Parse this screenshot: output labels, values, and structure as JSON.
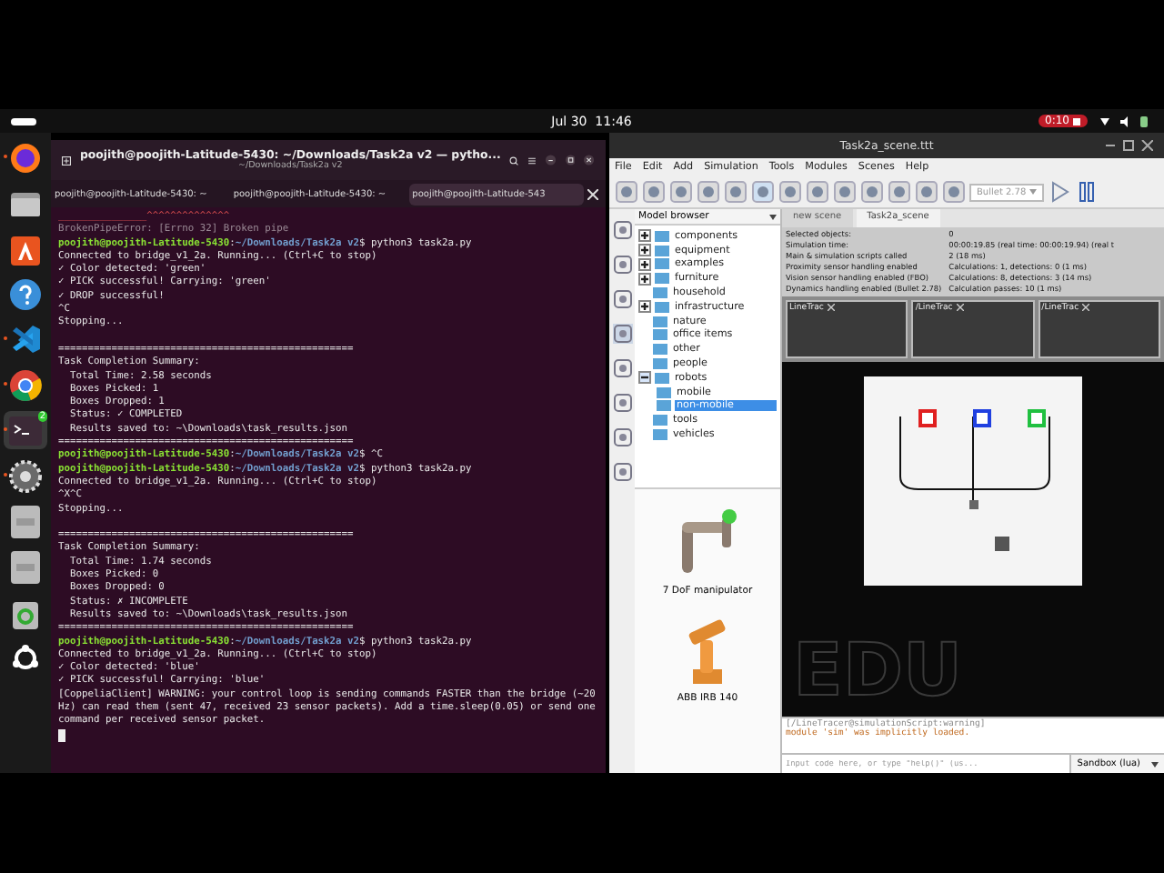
{
  "top_bar": {
    "date": "Jul 30",
    "time": "11:46",
    "recording": "0:10"
  },
  "dock": [
    {
      "kind": "browser",
      "running": true,
      "selected": false
    },
    {
      "kind": "files",
      "running": false,
      "selected": false
    },
    {
      "kind": "store",
      "running": false,
      "selected": false
    },
    {
      "kind": "help",
      "running": false,
      "selected": false
    },
    {
      "kind": "editor",
      "running": true,
      "selected": false
    },
    {
      "kind": "chrome",
      "running": true,
      "selected": false
    },
    {
      "kind": "terminal",
      "running": true,
      "selected": true,
      "badge": "2"
    },
    {
      "kind": "settings",
      "running": true,
      "selected": false
    },
    {
      "kind": "drive",
      "running": false,
      "selected": false
    },
    {
      "kind": "drive",
      "running": false,
      "selected": false
    },
    {
      "kind": "trash",
      "running": false,
      "selected": false
    },
    {
      "kind": "apps",
      "running": false,
      "selected": false
    }
  ],
  "terminal": {
    "title": "poojith@poojith-Latitude-5430: ~/Downloads/Task2a v2 — pytho...",
    "subtitle": "~/Downloads/Task2a v2",
    "tabs": [
      {
        "label": "poojith@poojith-Latitude-5430: ~",
        "selected": false
      },
      {
        "label": "poojith@poojith-Latitude-5430: ~",
        "selected": false
      },
      {
        "label": "poojith@poojith-Latitude-543",
        "selected": true
      }
    ],
    "lines": [
      {
        "kind": "marker",
        "text": "_______________^^^^^^^^^^^^^^"
      },
      {
        "kind": "error",
        "text": "BrokenPipeError: [Errno 32] Broken pipe"
      },
      {
        "kind": "prompt",
        "user": "poojith@poojith-Latitude-5430",
        "sep": ":",
        "path": "~/Downloads/Task2a v2",
        "text": "$ python3 task2a.py"
      },
      {
        "kind": "text",
        "text": "Connected to bridge_v1_2a. Running... (Ctrl+C to stop)"
      },
      {
        "kind": "text",
        "text": "✓ Color detected: 'green'"
      },
      {
        "kind": "text",
        "text": "✓ PICK successful! Carrying: 'green'"
      },
      {
        "kind": "text",
        "text": "✓ DROP successful!"
      },
      {
        "kind": "text",
        "text": "^C"
      },
      {
        "kind": "text",
        "text": "Stopping..."
      },
      {
        "kind": "blank"
      },
      {
        "kind": "text",
        "text": "=================================================="
      },
      {
        "kind": "text",
        "text": "Task Completion Summary:"
      },
      {
        "kind": "text",
        "text": "  Total Time: 2.58 seconds"
      },
      {
        "kind": "text",
        "text": "  Boxes Picked: 1"
      },
      {
        "kind": "text",
        "text": "  Boxes Dropped: 1"
      },
      {
        "kind": "text",
        "text": "  Status: ✓ COMPLETED"
      },
      {
        "kind": "text",
        "text": "  Results saved to: ~\\Downloads\\task_results.json"
      },
      {
        "kind": "text",
        "text": "=================================================="
      },
      {
        "kind": "prompt",
        "user": "poojith@poojith-Latitude-5430",
        "sep": ":",
        "path": "~/Downloads/Task2a v2",
        "text": "$ ^C"
      },
      {
        "kind": "prompt",
        "user": "poojith@poojith-Latitude-5430",
        "sep": ":",
        "path": "~/Downloads/Task2a v2",
        "text": "$ python3 task2a.py"
      },
      {
        "kind": "text",
        "text": "Connected to bridge_v1_2a. Running... (Ctrl+C to stop)"
      },
      {
        "kind": "text",
        "text": "^X^C"
      },
      {
        "kind": "text",
        "text": "Stopping..."
      },
      {
        "kind": "blank"
      },
      {
        "kind": "text",
        "text": "=================================================="
      },
      {
        "kind": "text",
        "text": "Task Completion Summary:"
      },
      {
        "kind": "text",
        "text": "  Total Time: 1.74 seconds"
      },
      {
        "kind": "text",
        "text": "  Boxes Picked: 0"
      },
      {
        "kind": "text",
        "text": "  Boxes Dropped: 0"
      },
      {
        "kind": "text",
        "text": "  Status: ✗ INCOMPLETE"
      },
      {
        "kind": "text",
        "text": "  Results saved to: ~\\Downloads\\task_results.json"
      },
      {
        "kind": "text",
        "text": "=================================================="
      },
      {
        "kind": "prompt",
        "user": "poojith@poojith-Latitude-5430",
        "sep": ":",
        "path": "~/Downloads/Task2a v2",
        "text": "$ python3 task2a.py"
      },
      {
        "kind": "text",
        "text": "Connected to bridge_v1_2a. Running... (Ctrl+C to stop)"
      },
      {
        "kind": "text",
        "text": "✓ Color detected: 'blue'"
      },
      {
        "kind": "text",
        "text": "✓ PICK successful! Carrying: 'blue'"
      },
      {
        "kind": "text",
        "text": "[CoppeliaClient] WARNING: your control loop is sending commands FASTER than the bridge (~20 Hz) can read them (sent 47, received 23 sensor packets). Add a time.sleep(0.05) or send one command per received sensor packet."
      },
      {
        "kind": "cursor"
      }
    ]
  },
  "sim": {
    "title": "Task2a_scene.ttt",
    "menu": [
      "File",
      "Edit",
      "Add",
      "Simulation",
      "Tools",
      "Modules",
      "Scenes",
      "Help"
    ],
    "engine": "Bullet 2.78",
    "browser_title": "Model browser",
    "tree": [
      {
        "label": "components",
        "expanded": false,
        "selected": false
      },
      {
        "label": "equipment",
        "expanded": false,
        "selected": false
      },
      {
        "label": "examples",
        "expanded": false,
        "selected": false
      },
      {
        "label": "furniture",
        "expanded": false,
        "selected": false
      },
      {
        "label": "household",
        "selected": false
      },
      {
        "label": "infrastructure",
        "expanded": false,
        "selected": false
      },
      {
        "label": "nature",
        "selected": false
      },
      {
        "label": "office items",
        "selected": false
      },
      {
        "label": "other",
        "selected": false
      },
      {
        "label": "people",
        "selected": false
      },
      {
        "label": "robots",
        "expanded": true,
        "selected": false,
        "children": [
          {
            "label": "mobile",
            "selected": false
          },
          {
            "label": "non-mobile",
            "selected": true
          }
        ]
      },
      {
        "label": "tools",
        "selected": false
      },
      {
        "label": "vehicles",
        "selected": false
      }
    ],
    "models": [
      {
        "label": "7 DoF manipulator",
        "kind": "arm"
      },
      {
        "label": "ABB IRB 140",
        "kind": "industrial"
      }
    ],
    "scene_tabs": [
      {
        "label": "new scene",
        "selected": false
      },
      {
        "label": "Task2a_scene",
        "selected": true
      }
    ],
    "info": [
      {
        "label": "Selected objects:",
        "value": "0"
      },
      {
        "label": "Simulation time:",
        "value": "00:00:19.85 (real time: 00:00:19.94) (real t"
      },
      {
        "label": "Main & simulation scripts called",
        "value": "2 (18 ms)"
      },
      {
        "label": "Proximity sensor handling enabled",
        "value": "Calculations: 1, detections: 0 (1 ms)"
      },
      {
        "label": "Vision sensor handling enabled (FBO)",
        "value": "Calculations: 8, detections: 3 (14 ms)"
      },
      {
        "label": "Dynamics handling enabled (Bullet 2.78)",
        "value": "Calculation passes: 10 (1 ms)"
      }
    ],
    "views": [
      "LineTrac",
      "/LineTrac",
      "/LineTrac"
    ],
    "markers": [
      {
        "color": "#e02020"
      },
      {
        "color": "#2040e0"
      },
      {
        "color": "#20c040"
      }
    ],
    "watermark": "EDU",
    "console": [
      {
        "kind": "source",
        "text": "[/LineTracer@simulationScript:warning]"
      },
      {
        "kind": "message",
        "text": "module 'sim' was implicitly loaded."
      }
    ],
    "input_placeholder": "Input code here, or type \"help()\" (us...",
    "sandbox": "Sandbox (lua)"
  }
}
